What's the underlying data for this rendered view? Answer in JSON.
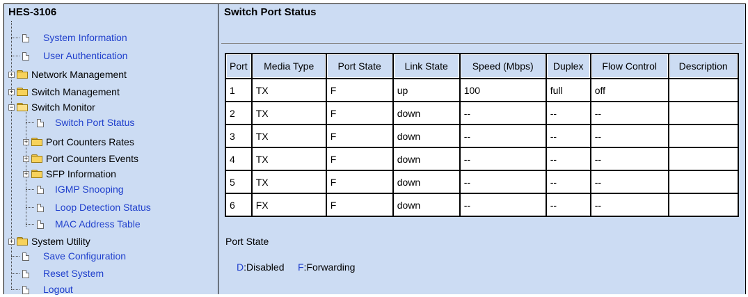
{
  "sidebar": {
    "title": "HES-3106",
    "items": [
      {
        "label": "System Information",
        "type": "page"
      },
      {
        "label": "User Authentication",
        "type": "page"
      },
      {
        "label": "Network Management",
        "type": "folder"
      },
      {
        "label": "Switch Management",
        "type": "folder"
      },
      {
        "label": "Switch Monitor",
        "type": "folder-open"
      },
      {
        "label": "Switch Port Status",
        "type": "page"
      },
      {
        "label": "Port Counters Rates",
        "type": "folder"
      },
      {
        "label": "Port Counters Events",
        "type": "folder"
      },
      {
        "label": "SFP Information",
        "type": "folder"
      },
      {
        "label": "IGMP Snooping",
        "type": "page"
      },
      {
        "label": "Loop Detection Status",
        "type": "page"
      },
      {
        "label": "MAC Address Table",
        "type": "page"
      },
      {
        "label": "System Utility",
        "type": "folder"
      },
      {
        "label": "Save Configuration",
        "type": "page"
      },
      {
        "label": "Reset System",
        "type": "page"
      },
      {
        "label": "Logout",
        "type": "page"
      }
    ]
  },
  "main": {
    "title": "Switch Port Status",
    "table": {
      "headers": [
        "Port",
        "Media Type",
        "Port State",
        "Link State",
        "Speed (Mbps)",
        "Duplex",
        "Flow Control",
        "Description"
      ],
      "rows": [
        [
          "1",
          "TX",
          "F",
          "up",
          "100",
          "full",
          "off",
          ""
        ],
        [
          "2",
          "TX",
          "F",
          "down",
          "--",
          "--",
          "--",
          ""
        ],
        [
          "3",
          "TX",
          "F",
          "down",
          "--",
          "--",
          "--",
          ""
        ],
        [
          "4",
          "TX",
          "F",
          "down",
          "--",
          "--",
          "--",
          ""
        ],
        [
          "5",
          "TX",
          "F",
          "down",
          "--",
          "--",
          "--",
          ""
        ],
        [
          "6",
          "FX",
          "F",
          "down",
          "--",
          "--",
          "--",
          ""
        ]
      ]
    },
    "legend": {
      "title": "Port State",
      "d_key": "D",
      "d_text": ":Disabled",
      "f_key": "F",
      "f_text": ":Forwarding"
    }
  },
  "colors": {
    "panel_bg": "#ccdcf3",
    "link": "#1f3fcc"
  }
}
